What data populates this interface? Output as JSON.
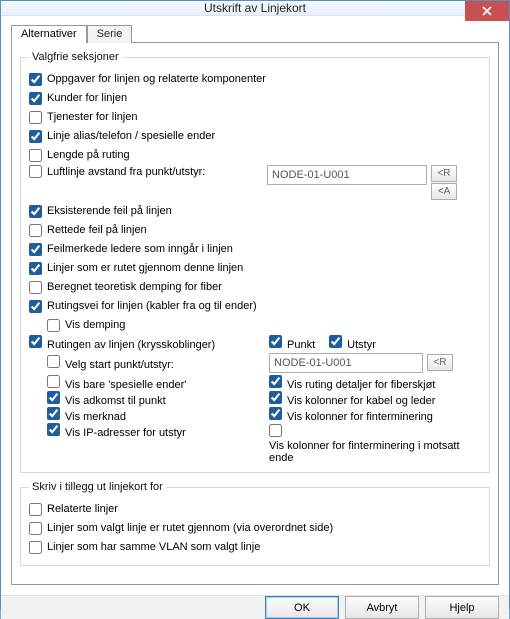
{
  "window": {
    "title": "Utskrift av Linjekort"
  },
  "tabs": {
    "alt": "Alternativer",
    "serie": "Serie"
  },
  "group1": {
    "legend": "Valgfrie seksjoner",
    "oppgaver": "Oppgaver for linjen og relaterte komponenter",
    "kunder": "Kunder for linjen",
    "tjenester": "Tjenester for linjen",
    "alias": "Linje alias/telefon / spesielle ender",
    "lengde": "Lengde på ruting",
    "luftlinje": "Luftlinje avstand fra punkt/utstyr:",
    "node_a": "NODE-01-U001",
    "btn_r": "<R",
    "btn_a": "<A",
    "eksisterende": "Eksisterende feil på linjen",
    "rettede": "Rettede feil på linjen",
    "feilmerkede": "Feilmerkede ledere som inngår i linjen",
    "linjer_rutet": "Linjer som er rutet gjennom denne linjen",
    "beregnet": "Beregnet teoretisk demping for fiber",
    "rutingsvei": "Rutingsvei for linjen (kabler fra og til ender)",
    "vis_demping": "Vis demping",
    "rutingen": "Rutingen av linjen (krysskoblinger)",
    "punkt": "Punkt",
    "utstyr": "Utstyr",
    "velg_start": "Velg start punkt/utstyr:",
    "node_b": "NODE-01-U001",
    "btn_r2": "<R",
    "vis_bare": "Vis bare 'spesielle ender'",
    "vis_ruting_detaljer": "Vis ruting detaljer for fiberskjøt",
    "vis_adkomst": "Vis adkomst til punkt",
    "vis_kolonner_kabel": "Vis kolonner for kabel og leder",
    "vis_merknad": "Vis merknad",
    "vis_kolonner_fint": "Vis kolonner for finterminering",
    "vis_ip": "Vis IP-adresser for utstyr",
    "vis_kolonner_fint_motsatt": "Vis kolonner for finterminering i motsatt ende"
  },
  "group2": {
    "legend": "Skriv i tillegg ut linjekort for",
    "relaterte": "Relaterte linjer",
    "linjer_via": "Linjer som valgt linje er rutet gjennom (via overordnet side)",
    "linjer_vlan": "Linjer som har samme VLAN som valgt linje"
  },
  "buttons": {
    "ok": "OK",
    "cancel": "Avbryt",
    "help": "Hjelp"
  }
}
